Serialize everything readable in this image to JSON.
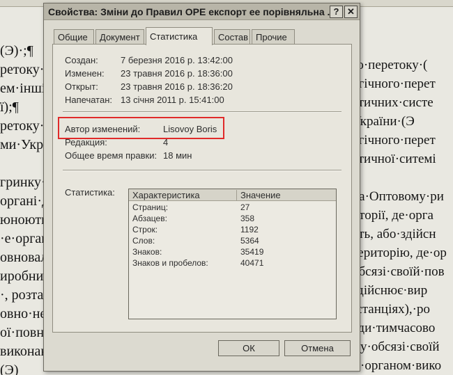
{
  "background_doc": {
    "left_lines": [
      "(Э)·;¶",
      "ретоку·е",
      "ем·інші",
      "ї);¶",
      "ретоку·е",
      "ми·Укра",
      "",
      "гринку·",
      "органі·д",
      "юноють",
      "·е·орган",
      "овновал",
      "иробниц",
      "·, розта",
      "овно·не·з",
      "ої·повно",
      "виконав",
      "(Э)"
    ],
    "right_lines": [
      "го·перетоку·(",
      "огічного·перет",
      "ятичних·систе",
      "України·(Э",
      "огічного·перет",
      "ятичної·ситемі",
      "",
      "на·Оптовому·ри",
      "иторії, де·орга",
      "оть, або·здійсн",
      "територію, де·ор",
      "обсязі·своїй·пов",
      "здійснює·вир",
      "(станціях),·ро",
      "ади·тимчасово",
      "му·обсязі·своїй",
      "м·органом·вико"
    ]
  },
  "window": {
    "title": "Свойства: Зміни до Правил ОРЕ експорт ее порівняльна ...",
    "help_glyph": "?",
    "close_glyph": "✕"
  },
  "tabs": [
    "Общие",
    "Документ",
    "Статистика",
    "Состав",
    "Прочие"
  ],
  "dates": [
    {
      "label": "Создан:",
      "value": "7 березня 2016 р. 13:42:00"
    },
    {
      "label": "Изменен:",
      "value": "23 травня 2016 р. 18:36:00"
    },
    {
      "label": "Открыт:",
      "value": "23 травня 2016 р. 18:36:20"
    },
    {
      "label": "Напечатан:",
      "value": "13 січня 2011 р. 15:41:00"
    }
  ],
  "meta": [
    {
      "label": "Автор изменений:",
      "value": "Lisovoy Boris"
    },
    {
      "label": "Редакция:",
      "value": "4"
    },
    {
      "label": "Общее время правки:",
      "value": "18 мин"
    }
  ],
  "stats": {
    "label": "Статистика:",
    "headers": [
      "Характеристика",
      "Значение"
    ],
    "rows": [
      {
        "name": "Страниц:",
        "value": "27"
      },
      {
        "name": "Абзацев:",
        "value": "358"
      },
      {
        "name": "Строк:",
        "value": "1192"
      },
      {
        "name": "Слов:",
        "value": "5364"
      },
      {
        "name": "Знаков:",
        "value": "35419"
      },
      {
        "name": "Знаков и пробелов:",
        "value": "40471"
      }
    ]
  },
  "buttons": {
    "ok": "ОК",
    "cancel": "Отмена"
  },
  "colors": {
    "highlight": "#e02a2a",
    "dialog_bg": "#dcdad0"
  }
}
